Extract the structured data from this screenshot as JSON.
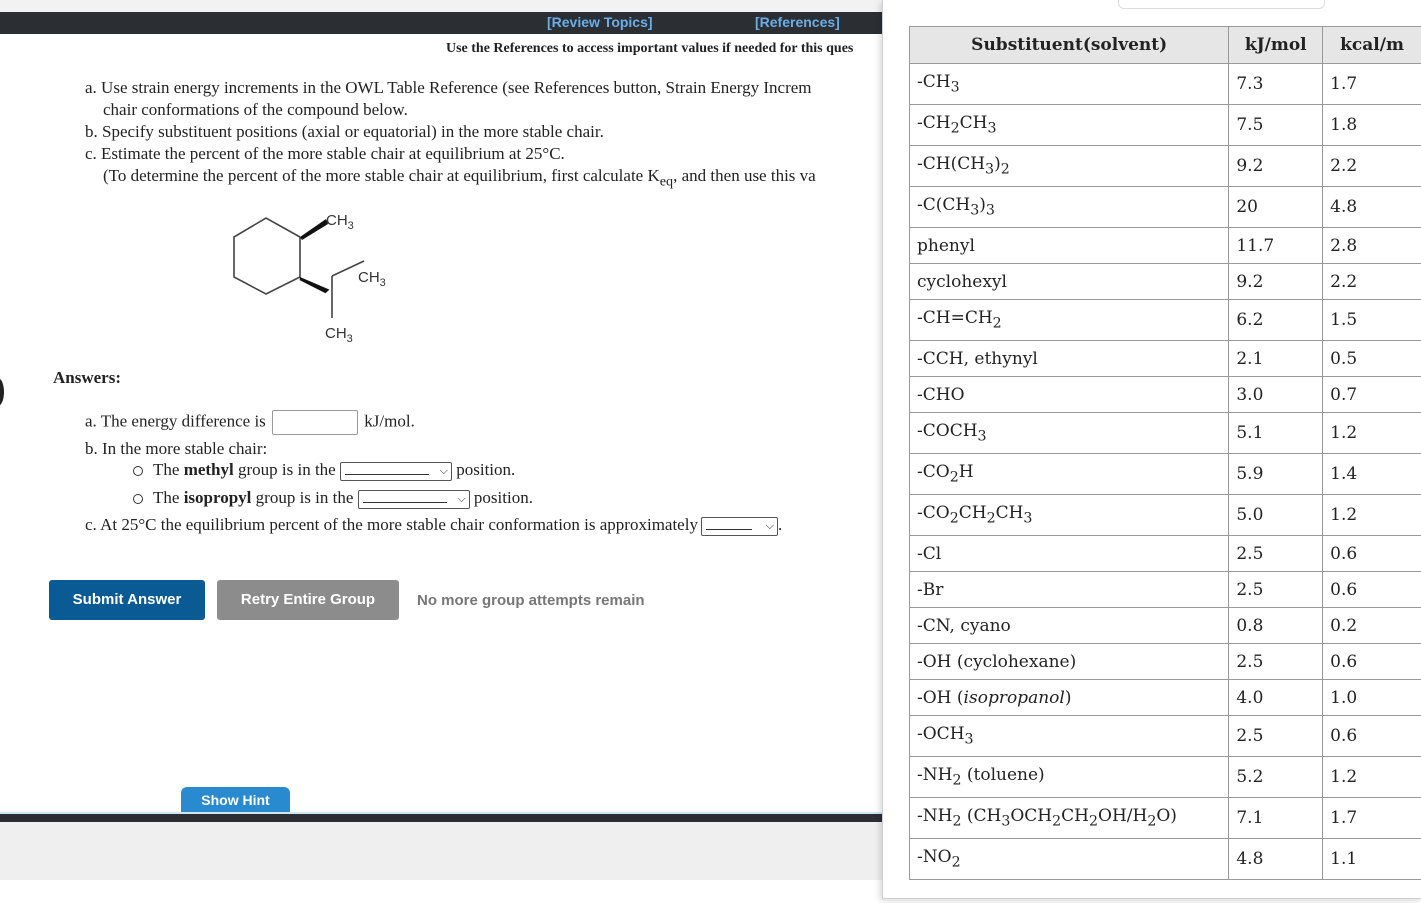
{
  "top_nav": {
    "review_topics": "[Review Topics]",
    "references": "[References]"
  },
  "ref_note": "Use the References to access important values if needed for this ques",
  "question": {
    "a_line1": "a. Use strain energy increments in the OWL Table Reference (see References button, Strain Energy Increm",
    "a_line2": "chair conformations of the compound below.",
    "b": "b. Specify substituent positions (axial or equatorial) in the more stable chair.",
    "c": "c. Estimate the percent of the more stable chair at equilibrium at 25°C.",
    "c_note_pre": "(To determine the percent of the more stable chair at equilibrium, first calculate K",
    "c_note_sub": "eq",
    "c_note_post": ", and then use this va"
  },
  "structure_labels": {
    "top": "CH3",
    "right": "CH3",
    "bottom": "CH3"
  },
  "answers": {
    "heading": "Answers:",
    "a_pre": "a. The energy difference is",
    "a_unit": "kJ/mol.",
    "a_value": "",
    "b_head": "b. In the more stable chair:",
    "b1_pre": "The ",
    "b1_bold": "methyl",
    "b1_post": " group is in the",
    "b1_after": "position.",
    "b1_selected": "",
    "b2_pre": "The ",
    "b2_bold": "isopropyl",
    "b2_post": " group is in the",
    "b2_after": "position.",
    "b2_selected": "",
    "c_pre": "c. At 25°C the equilibrium percent of the more stable chair conformation is approximately",
    "c_after": ".",
    "c_selected": ""
  },
  "buttons": {
    "submit": "Submit Answer",
    "retry": "Retry Entire Group",
    "attempts": "No more group attempts remain",
    "hint": "Show Hint"
  },
  "strain_table": {
    "headers": [
      "Substituent(solvent)",
      "kJ/mol",
      "kcal/m"
    ],
    "rows": [
      {
        "main": "-CH",
        "sub": "3",
        "rest": "",
        "kj": "7.3",
        "kcal": "1.7"
      },
      {
        "main": "-CH",
        "sub": "2",
        "rest": "CH",
        "sub2": "3",
        "kj": "7.5",
        "kcal": "1.8"
      },
      {
        "main": "-CH(CH",
        "sub": "3",
        "rest": ")",
        "sub2": "2",
        "kj": "9.2",
        "kcal": "2.2"
      },
      {
        "main": "-C(CH",
        "sub": "3",
        "rest": ")",
        "sub2": "3",
        "kj": "20",
        "kcal": "4.8"
      },
      {
        "main": "phenyl",
        "sub": "",
        "rest": "",
        "kj": "11.7",
        "kcal": "2.8"
      },
      {
        "main": "cyclohexyl",
        "sub": "",
        "rest": "",
        "kj": "9.2",
        "kcal": "2.2"
      },
      {
        "main": "-CH=CH",
        "sub": "2",
        "rest": "",
        "kj": "6.2",
        "kcal": "1.5"
      },
      {
        "main": "-CCH, ethynyl",
        "sub": "",
        "rest": "",
        "kj": "2.1",
        "kcal": "0.5"
      },
      {
        "main": "-CHO",
        "sub": "",
        "rest": "",
        "kj": "3.0",
        "kcal": "0.7"
      },
      {
        "main": "-COCH",
        "sub": "3",
        "rest": "",
        "kj": "5.1",
        "kcal": "1.2"
      },
      {
        "main": "-CO",
        "sub": "2",
        "rest": "H",
        "kj": "5.9",
        "kcal": "1.4"
      },
      {
        "main": "-CO",
        "sub": "2",
        "rest": "CH",
        "sub2": "2",
        "rest2": "CH",
        "sub3": "3",
        "kj": "5.0",
        "kcal": "1.2"
      },
      {
        "main": "-Cl",
        "sub": "",
        "rest": "",
        "kj": "2.5",
        "kcal": "0.6"
      },
      {
        "main": "-Br",
        "sub": "",
        "rest": "",
        "kj": "2.5",
        "kcal": "0.6"
      },
      {
        "main": "-CN, cyano",
        "sub": "",
        "rest": "",
        "kj": "0.8",
        "kcal": "0.2"
      },
      {
        "main": "-OH (cyclohexane)",
        "sub": "",
        "rest": "",
        "kj": "2.5",
        "kcal": "0.6"
      },
      {
        "main": "-OH (",
        "italic": "isopropanol",
        "rest_after_italic": ")",
        "sub": "",
        "rest": "",
        "kj": "4.0",
        "kcal": "1.0"
      },
      {
        "main": "-OCH",
        "sub": "3",
        "rest": "",
        "kj": "2.5",
        "kcal": "0.6"
      },
      {
        "main": "-NH",
        "sub": "2",
        "rest": " (toluene)",
        "kj": "5.2",
        "kcal": "1.2"
      },
      {
        "main": "-NH",
        "sub": "2",
        "rest": " (CH",
        "sub2": "3",
        "rest2": "OCH",
        "sub3": "2",
        "rest3": "CH",
        "sub4": "2",
        "rest4": "OH/H",
        "sub5": "2",
        "rest5": "O)",
        "kj": "7.1",
        "kcal": "1.7"
      },
      {
        "main": "-NO",
        "sub": "2",
        "rest": "",
        "kj": "4.8",
        "kcal": "1.1"
      }
    ]
  },
  "colors": {
    "nav_bar": "#2b2f33",
    "nav_link": "#6aaee8",
    "submit_button": "#0a5a93",
    "retry_button": "#8c8c8c",
    "hint_button": "#2a8ad0",
    "table_header": "#e6e6e6"
  }
}
